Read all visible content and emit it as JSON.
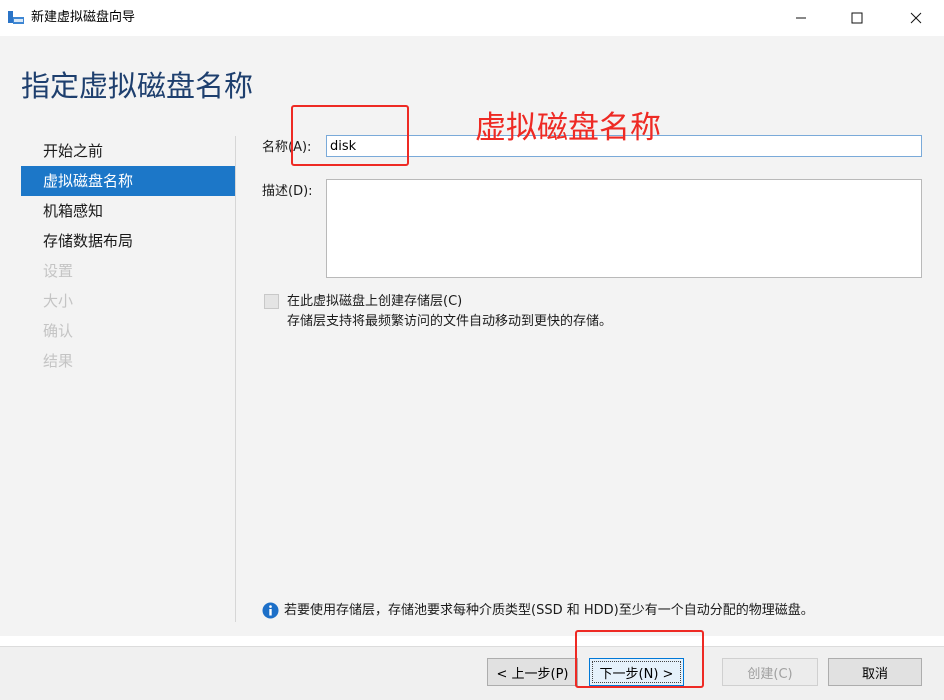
{
  "window": {
    "title": "新建虚拟磁盘向导",
    "controls": [
      "minimize-icon",
      "maximize-icon",
      "close-icon"
    ]
  },
  "page": {
    "title": "指定虚拟磁盘名称"
  },
  "nav": {
    "items": [
      {
        "label": "开始之前",
        "state": "normal"
      },
      {
        "label": "虚拟磁盘名称",
        "state": "selected"
      },
      {
        "label": "机箱感知",
        "state": "normal"
      },
      {
        "label": "存储数据布局",
        "state": "normal"
      },
      {
        "label": "设置",
        "state": "disabled"
      },
      {
        "label": "大小",
        "state": "disabled"
      },
      {
        "label": "确认",
        "state": "disabled"
      },
      {
        "label": "结果",
        "state": "disabled"
      }
    ]
  },
  "form": {
    "name_label": "名称(A):",
    "name_value": "disk",
    "description_label": "描述(D):",
    "description_value": "",
    "tier_checkbox_label": "在此虚拟磁盘上创建存储层(C)",
    "tier_checkbox_checked": false,
    "tier_hint": "存储层支持将最频繁访问的文件自动移动到更快的存储。"
  },
  "info": {
    "icon": "info-icon",
    "text": "若要使用存储层，存储池要求每种介质类型(SSD 和 HDD)至少有一个自动分配的物理磁盘。"
  },
  "buttons": {
    "prev": "< 上一步(P)",
    "next": "下一步(N) >",
    "create": "创建(C)",
    "cancel": "取消"
  },
  "annotation": {
    "text": "虚拟磁盘名称",
    "color": "#ee2a24"
  },
  "colors": {
    "accent": "#1c77c8",
    "title": "#1e3f6e"
  }
}
